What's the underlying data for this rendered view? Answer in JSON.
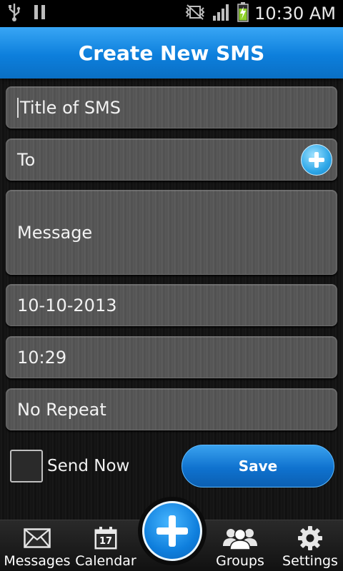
{
  "status_bar": {
    "time": "10:30 AM",
    "usb_icon": "usb-icon",
    "pause_icon": "pause-icon",
    "mute_icon": "vibrate-off-icon",
    "signal_icon": "signal-icon",
    "battery_icon": "battery-charging-icon"
  },
  "header": {
    "title": "Create New SMS"
  },
  "form": {
    "title_placeholder": "Title of SMS",
    "to_label": "To",
    "message_label": "Message",
    "date_value": "10-10-2013",
    "time_value": "10:29",
    "repeat_value": "No Repeat"
  },
  "actions": {
    "send_now_label": "Send Now",
    "save_label": "Save"
  },
  "bottom_nav": {
    "messages": "Messages",
    "calendar": "Calendar",
    "calendar_day": "17",
    "groups": "Groups",
    "settings": "Settings"
  },
  "colors": {
    "accent": "#0d7fdc",
    "accent_light": "#38a6f5"
  }
}
